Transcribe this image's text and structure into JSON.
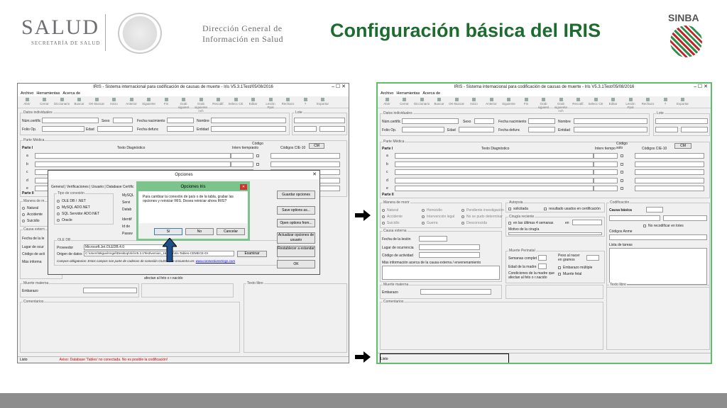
{
  "header": {
    "salud": "SALUD",
    "secretaria": "SECRETARÍA DE SALUD",
    "dg_line1": "Dirección General de",
    "dg_line2": "Información en Salud",
    "title": "Configuración básica del IRIS",
    "sinba": "SINBA"
  },
  "left_window": {
    "title": "IRIS - Sistema internacional para codificación de causas de muerte - Iris V5.3.1Test/05/08/2016",
    "menu": [
      "Archivo",
      "Herramientas",
      "Acerca de"
    ],
    "toolbar": [
      "Abrir",
      "Cerrar",
      "Diccionario",
      "Buscar",
      "OK-Buscar",
      "Inicio",
      "Anterior",
      "Siguiente",
      "Fin",
      "Grab siguient",
      "Grab siguiente nch",
      "Recodif.",
      "Selecc CE",
      "Editar",
      "Lesión Ppal",
      "Rechazo",
      "?",
      "Exportar"
    ],
    "datos_individuales": "Datos individuales",
    "num_certif": "Núm.certific",
    "sexo": "Sexo",
    "fecha_nac": "Fecha nacimiento",
    "nombre": "Nombre",
    "folio": "Folio Op.",
    "edad": "Edad",
    "fecha_def": "Fecha defunc",
    "entidad": "Entidad",
    "lote": "Lote",
    "parte_medica": "Parte Médica",
    "parte1": "Parte I",
    "texto_diag": "Texto Diagnóstico",
    "intervalo": "Interv tiempo",
    "codigo_solo": "Código solo",
    "codigos": "Códigos CIE-10",
    "cm": "CM",
    "rows": [
      "a",
      "b",
      "c",
      "d",
      "e"
    ],
    "parte2": "Parte II",
    "manera": "Manera de m",
    "natural": "Natural",
    "accidente": "Accidente",
    "suicidio": "Suicidio",
    "causa_ext": "Causa extern",
    "fecha_les": "Fecha de la le",
    "lugar": "Lugar de ocur",
    "codigo_act": "Código de acti",
    "mas_info": "Más informa",
    "muerte_materna": "Muerte materna",
    "embarazo": "Embarazo",
    "afectan": "afectan al feto o r.nacido",
    "texto_libre": "Texto libre",
    "comentarios": "Comentarios",
    "status_left": "Listo",
    "status_warn": "Aviso: Database 'Tables' no conectada. No es posible la codificación!"
  },
  "opciones": {
    "title": "Opciones",
    "tabs": [
      "General",
      "Verificaciones",
      "Usuario",
      "Database Certific"
    ],
    "tipo_conexion": "Tipo de conexión",
    "radios": [
      "OLE DB / .NET",
      "MySQL ADO.NET",
      "SQL Servidor ADO.NET",
      "Oracle"
    ],
    "mysql": "MySQL",
    "servi": "Servi",
    "datab": "Datab",
    "identif": "Identif",
    "id_de": "Id de",
    "passw": "Passw",
    "ole_db": "OLE DB",
    "proveedor_lbl": "Proveedor",
    "proveedor_val": "Microsoft.Jet.OLEDB.4.0",
    "origen_lbl": "Origen de datos",
    "origen_val": "C:\\Users\\MiguelAngel\\Desktop\\Iris\\V5.3.1Test\\version_160805\\Iris-Tables-CEMECE-DI",
    "examinar": "Examinar",
    "obligatorios": "Campos obligatorios: Estos campos son parte de cadenas de conexión OLEDB, se encuentra en:",
    "url": "www.connectionstrings.com",
    "guardar": "Guardar opciones",
    "save_as": "Save options as...",
    "open_from": "Open options from...",
    "actualizar": "Actualizar opciones de usuario",
    "restablecer": "Restablecer a estandar",
    "ok": "OK"
  },
  "opciones_iris": {
    "title": "Opciones Iris",
    "message": "Para cambiar la conexión de país o de la tabla, grabar las opciones y reiniciar IRIS. Desea reiniciar ahora IRIS?",
    "si": "Sí",
    "no": "No",
    "cancelar": "Cancelar"
  },
  "right_window": {
    "title": "IRIS - Sistema internacional para codificación de causas de muerte - Iris V5.3.1Test/05/08/2016",
    "manera": "Manera de morir",
    "natural": "Natural",
    "homicidio": "Homicidio",
    "pendiente": "Pendiente investigación",
    "accidente": "Accidente",
    "intervencion": "Intervención legal",
    "no_determinar": "No se pudo determinar",
    "suicidio": "Suicidio",
    "guerra": "Guerra",
    "desconocida": "Desconocida",
    "autopsia": "Autopsia",
    "solicitada": "solicitada",
    "resultado": "resultado usados en certificación",
    "cirugia": "Cirugía reciente",
    "ultimas": "en las últimas 4 semanas",
    "en": "en",
    "motivo": "Motivo de la cirugía",
    "codificacion": "Codificación",
    "causa_basica": "Causa básica",
    "no_recodificar": "No recodificar en lotes",
    "codigos_anme": "Códigos Anme",
    "lista_tareas": "Lista de tareas",
    "causa_ext": "Causa externa",
    "fecha_lesion": "Fecha de la lesión",
    "lugar": "Lugar de ocurrencia",
    "codigo_act": "Código de actividad",
    "mas_info": "Más información acerca de la causa externa / envenenamiento",
    "perinatal": "Muerte Perinatal",
    "semanas": "Semanas complet",
    "peso": "Peso al nacer en gramos",
    "edad_madre": "Edad de la madre",
    "multiple": "Embarazo múltiple",
    "fetal": "Muerte fetal",
    "condiciones": "Condiciones de la madre que afectan al feto o r.nacido",
    "muerte_materna": "Muerte materna",
    "embarazo": "Embarazo",
    "texto_libre": "Texto libre",
    "comentarios": "Comentarios",
    "status": "Listo"
  }
}
